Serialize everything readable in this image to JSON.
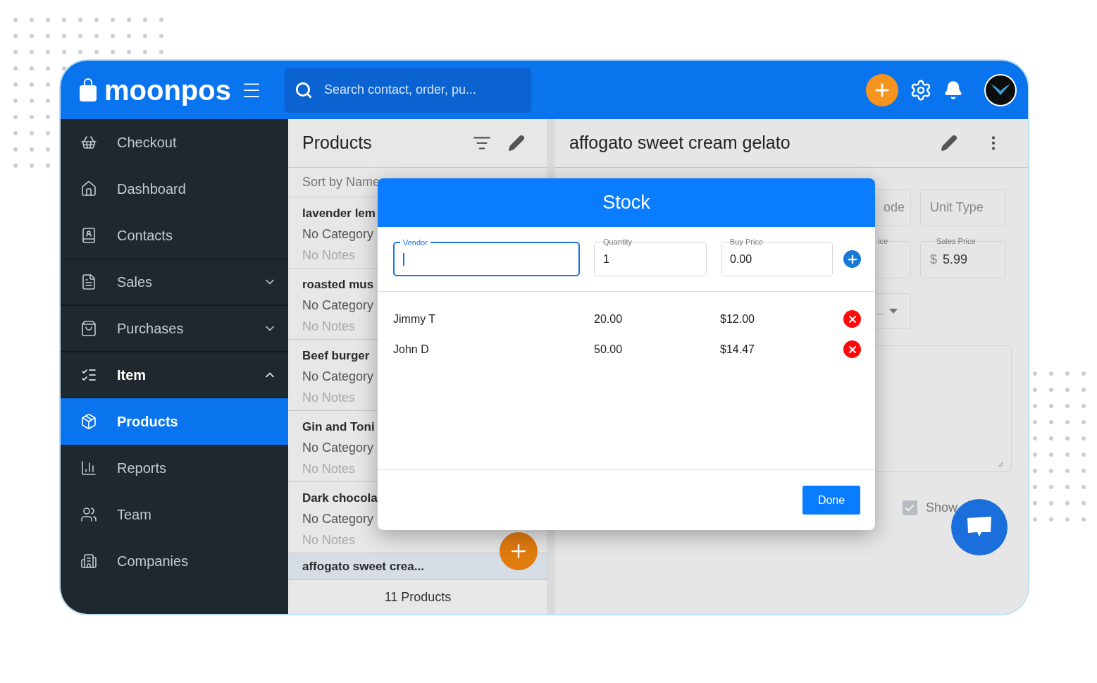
{
  "header": {
    "logo": "moonpos",
    "search": {
      "placeholder": "Search contact, order, pu..."
    }
  },
  "sidebar": {
    "items": [
      {
        "label": "Checkout",
        "selected": false
      },
      {
        "label": "Dashboard",
        "selected": false
      },
      {
        "label": "Contacts",
        "selected": false
      },
      {
        "label": "Sales",
        "selected": false,
        "expanded": false
      },
      {
        "label": "Purchases",
        "selected": false,
        "expanded": false
      },
      {
        "label": "Item",
        "selected": false,
        "expanded": true,
        "children": [
          {
            "label": "Products",
            "selected": true
          }
        ]
      },
      {
        "label": "Reports",
        "selected": false
      },
      {
        "label": "Team",
        "selected": false
      },
      {
        "label": "Companies",
        "selected": false
      }
    ]
  },
  "product_list": {
    "title": "Products",
    "sort_label": "Sort by Name",
    "items": [
      {
        "name": "lavender lem",
        "category": "No Category",
        "notes": "No Notes",
        "selected": false
      },
      {
        "name": "roasted mus",
        "category": "No Category",
        "notes": "No Notes",
        "selected": false
      },
      {
        "name": "Beef burger",
        "category": "No Category",
        "notes": "No Notes",
        "selected": false
      },
      {
        "name": "Gin and Toni",
        "category": "No Category",
        "notes": "No Notes",
        "selected": false
      },
      {
        "name": "Dark chocola",
        "category": "No Category",
        "notes": "No Notes",
        "selected": false
      },
      {
        "name": "affogato sweet crea...",
        "selected": true
      }
    ],
    "footer": "11 Products"
  },
  "product_detail": {
    "title": "affogato sweet cream gelato",
    "row_1": [
      {
        "placeholder": "ode"
      },
      {
        "placeholder": "Unit Type"
      }
    ],
    "row_2": [
      {
        "label": "ice"
      },
      {
        "label": "Sales Price",
        "prefix": "$",
        "value": "5.99"
      }
    ],
    "select": {
      "placeholder": ".."
    },
    "checkbox": {
      "label": "Show",
      "checked": true
    }
  },
  "stock_dialog": {
    "title": "Stock",
    "fields": [
      {
        "label": "Vendor",
        "focused": true
      },
      {
        "label": "Quantity",
        "value": "1",
        "focused": false
      },
      {
        "label": "Buy Price",
        "value": "0.00",
        "focused": false
      }
    ],
    "rows": [
      {
        "vendor": "Jimmy T",
        "quantity": "20.00",
        "price": "$12.00"
      },
      {
        "vendor": "John D",
        "quantity": "50.00",
        "price": "$14.47"
      }
    ],
    "done_button": "Done"
  }
}
